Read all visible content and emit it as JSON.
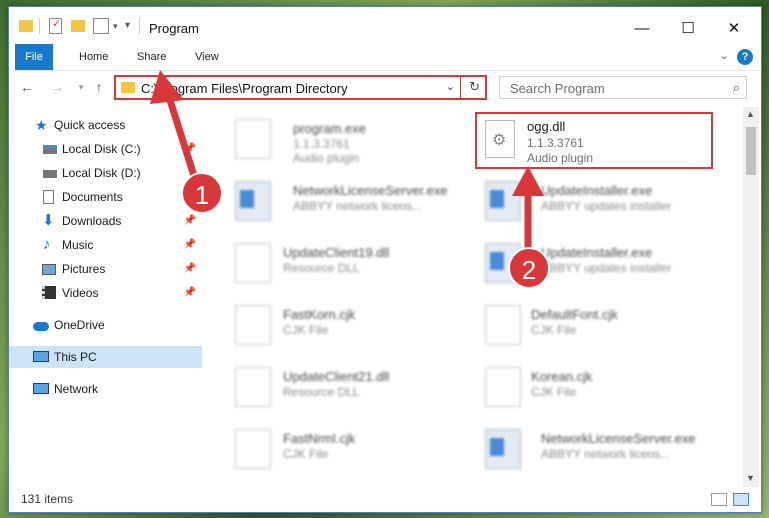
{
  "window": {
    "title": "Program"
  },
  "ribbon": {
    "tabs": [
      "File",
      "Home",
      "Share",
      "View"
    ],
    "help": "?"
  },
  "address": {
    "path": "C:\\Program Files\\Program Directory"
  },
  "search": {
    "placeholder": "Search Program"
  },
  "nav": {
    "quick_access": "Quick access",
    "items": [
      "Local Disk (C:)",
      "Local Disk (D:)",
      "Documents",
      "Downloads",
      "Music",
      "Pictures",
      "Videos"
    ],
    "onedrive": "OneDrive",
    "this_pc": "This PC",
    "network": "Network"
  },
  "files": [
    {
      "name": "program.exe",
      "ver": "1.1.3.3761",
      "desc": "Audio plugin",
      "kind": "gear"
    },
    {
      "name": "ogg.dll",
      "ver": "1.1.3.3761",
      "desc": "Audio plugin",
      "kind": "gear"
    },
    {
      "name": "NetworkLicenseServer.exe",
      "desc": "ABBYY network licens...",
      "kind": "app"
    },
    {
      "name": "UpdateInstaller.exe",
      "desc": "ABBYY updates installer",
      "kind": "app"
    },
    {
      "name": "UpdateClient19.dll",
      "desc": "Resource DLL",
      "kind": "gear"
    },
    {
      "name": "UpdateInstaller.exe",
      "desc": "ABBYY updates installer",
      "kind": "app"
    },
    {
      "name": "FastKorn.cjk",
      "desc": "CJK File",
      "kind": "doc"
    },
    {
      "name": "DefaultFont.cjk",
      "desc": "CJK File",
      "kind": "doc"
    },
    {
      "name": "UpdateClient21.dll",
      "desc": "Resource DLL",
      "kind": "gear"
    },
    {
      "name": "Korean.cjk",
      "desc": "CJK File",
      "kind": "doc"
    },
    {
      "name": "FastNrml.cjk",
      "desc": "CJK File",
      "kind": "doc"
    },
    {
      "name": "NetworkLicenseServer.exe",
      "desc": "ABBYY network licens...",
      "kind": "app"
    }
  ],
  "status": {
    "count": "131 items"
  },
  "annotations": {
    "step1": "1",
    "step2": "2"
  },
  "colors": {
    "accent": "#1979ca",
    "annotation": "#d9383a",
    "selected": "#cce4f7"
  }
}
